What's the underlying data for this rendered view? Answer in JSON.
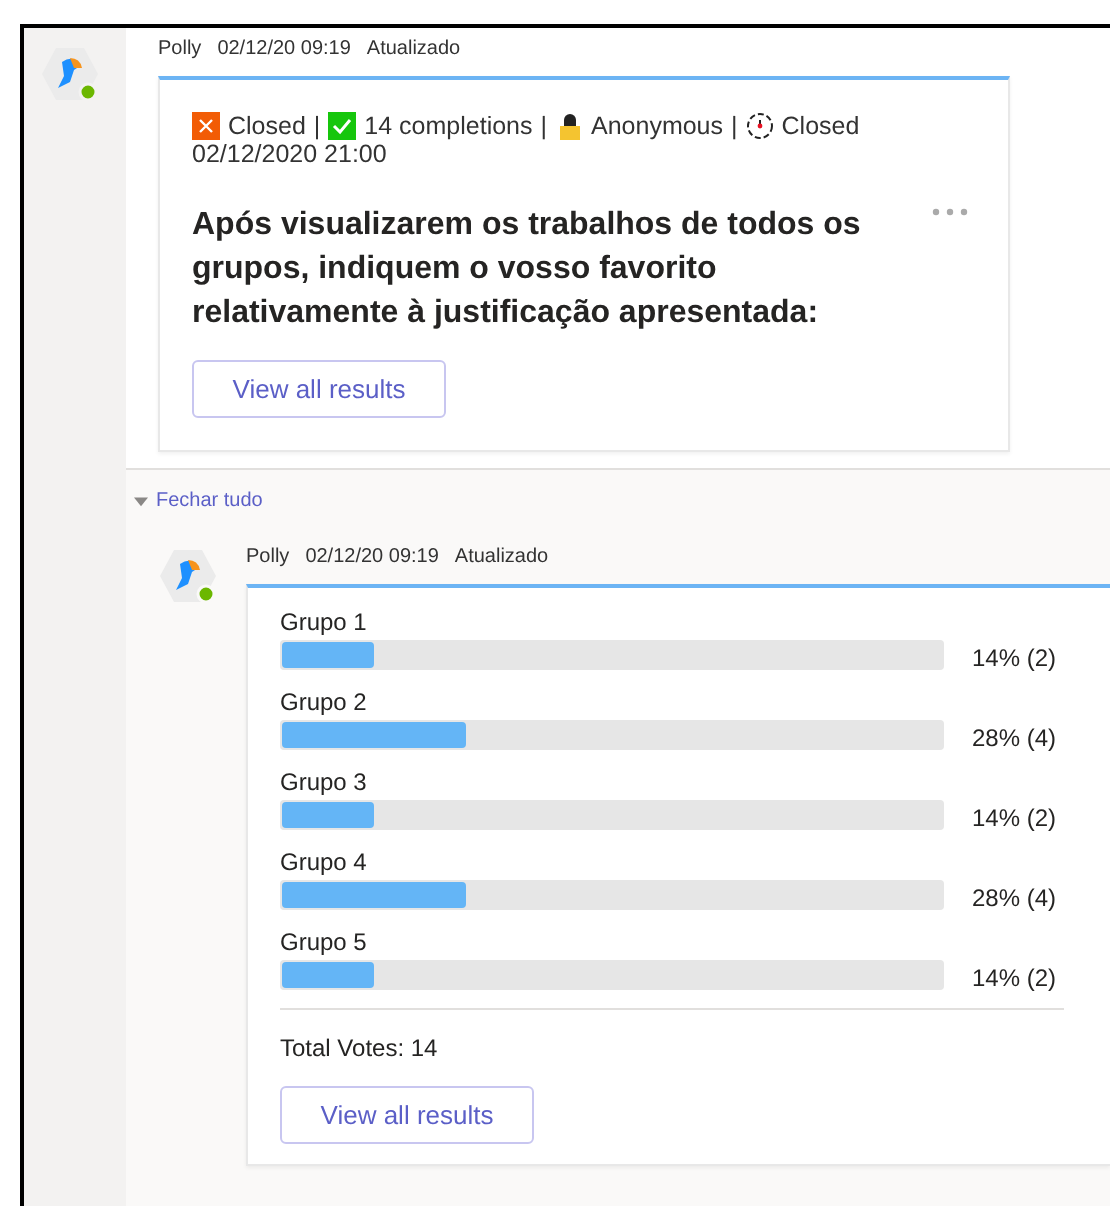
{
  "message": {
    "author": "Polly",
    "timestamp": "02/12/20 09:19",
    "edited": "Atualizado",
    "status": [
      {
        "kind": "closed",
        "text": "Closed"
      },
      {
        "kind": "separator",
        "text": "|"
      },
      {
        "kind": "completions",
        "text": "14 completions"
      },
      {
        "kind": "separator",
        "text": "|"
      },
      {
        "kind": "anonymous",
        "text": "Anonymous"
      },
      {
        "kind": "separator",
        "text": "|"
      },
      {
        "kind": "deadline",
        "text": "Closed"
      }
    ],
    "deadline": "02/12/2020 21:00",
    "question": "Após visualizarem os trabalhos de todos os grupos, indiquem o vosso favorito relativamente à justificação apresentada:",
    "button": "View all results"
  },
  "collapse": {
    "label": "Fechar tudo",
    "expanded": true
  },
  "reply": {
    "author": "Polly",
    "timestamp": "02/12/20 09:19",
    "edited": "Atualizado",
    "options": [
      {
        "label": "Grupo 1",
        "level": 0.14,
        "result": "14% (2)"
      },
      {
        "label": "Grupo 2",
        "level": 0.28,
        "result": "28% (4)"
      },
      {
        "label": "Grupo 3",
        "level": 0.14,
        "result": "14% (2)"
      },
      {
        "label": "Grupo 4",
        "level": 0.28,
        "result": "28% (4)"
      },
      {
        "label": "Grupo 5",
        "level": 0.14,
        "result": "14% (2)"
      }
    ],
    "total": "Total Votes: 14",
    "button": "View all results"
  }
}
